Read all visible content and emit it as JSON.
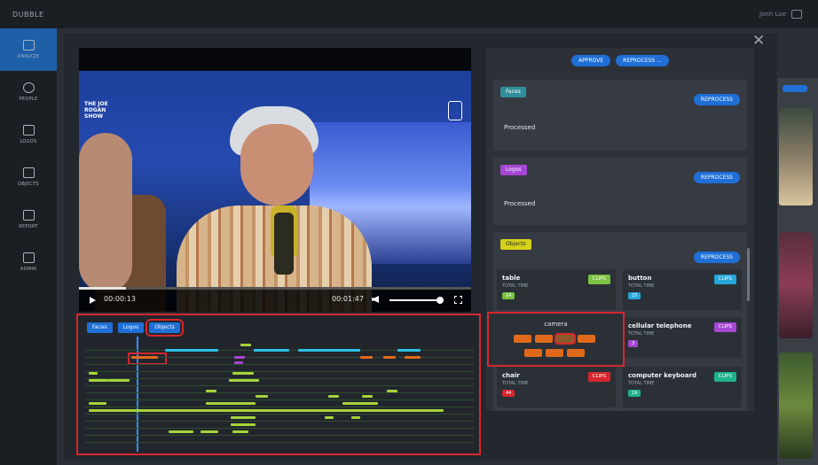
{
  "app": {
    "brand": "DUBBLE",
    "user": "Jonh Lue"
  },
  "sidebar": {
    "items": [
      {
        "label": "ANALYZE",
        "icon": "dashboard-icon"
      },
      {
        "label": "PEOPLE",
        "icon": "face-icon"
      },
      {
        "label": "LOGOS",
        "icon": "logo-icon"
      },
      {
        "label": "OBJECTS",
        "icon": "objects-icon"
      },
      {
        "label": "REPORT",
        "icon": "chart-icon"
      },
      {
        "label": "ADMIN",
        "icon": "admin-icon"
      }
    ]
  },
  "video": {
    "logo_left": "THE JOE ROGAN SHOW",
    "current_time": "00:00:13",
    "duration": "00:01:47",
    "progress": 0.12,
    "volume": 0.9
  },
  "timeline": {
    "tabs": [
      "Faces",
      "Logos",
      "Objects"
    ],
    "selected_tab": "Objects"
  },
  "panel": {
    "top_buttons": [
      "APPROVE",
      "REPROCESS ..."
    ],
    "cards": [
      {
        "tag": "Faces",
        "tag_color": "#2f8f9a",
        "button": "REPROCESS",
        "status": "Processed"
      },
      {
        "tag": "Logos",
        "tag_color": "#a647d3",
        "button": "REPROCESS",
        "status": "Processed"
      },
      {
        "tag": "Objects",
        "tag_color": "#d6d21a",
        "button": "REPROCESS"
      }
    ],
    "objects": [
      {
        "name": "table",
        "meta": "TOTAL TIME",
        "count": "14",
        "count_color": "#7ac241",
        "clips": "CLIPS",
        "clips_color": "#7ac241"
      },
      {
        "name": "button",
        "meta": "TOTAL TIME",
        "count": "23",
        "count_color": "#25a6d8",
        "clips": "CLIPS",
        "clips_color": "#25a6d8"
      },
      {
        "name": "cellular telephone",
        "meta": "TOTAL TIME",
        "count": "3",
        "count_color": "#a647d3",
        "clips": "CLIPS",
        "clips_color": "#a647d3"
      },
      {
        "name": "chair",
        "meta": "TOTAL TIME",
        "count": "44",
        "count_color": "#d7262e",
        "clips": "CLIPS",
        "clips_color": "#d7262e"
      },
      {
        "name": "computer keyboard",
        "meta": "TOTAL TIME",
        "count": "19",
        "count_color": "#1fb38a",
        "clips": "CLIPS",
        "clips_color": "#1fb38a"
      }
    ],
    "camera": {
      "title": "camera"
    }
  },
  "colors": {
    "accent": "#1f6fd6",
    "highlight": "#d7262e"
  }
}
